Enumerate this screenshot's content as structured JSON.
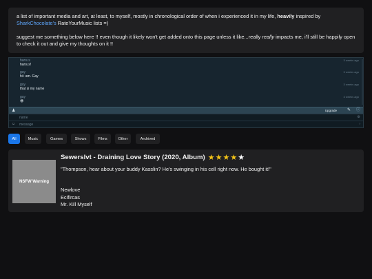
{
  "intro": {
    "line1_a": "a list of important media and art, at least, to myself, mostly in chronological order of when i experienced it in my life, ",
    "line1_bold": "heavily",
    "line1_b": " inspired by ",
    "link": "SharkChocolate's",
    "line1_c": " RateYourMusic lists =)",
    "line2_a": "suggest me something below here !! even though it likely won't get added onto this page unless it like...really ",
    "line2_italic": "really",
    "line2_b": " impacts me, i'll still be happily open to check it out and give my thoughts on it !!"
  },
  "chat": {
    "messages": [
      {
        "user": "hans.s",
        "text": "hans.s!",
        "time": "3 weeks ago"
      },
      {
        "user": "guy",
        "text": "hi i am. Gay",
        "time": "3 weeks ago"
      },
      {
        "user": "guy",
        "text": "that si my name",
        "time": "3 weeks ago"
      },
      {
        "user": "guy",
        "text": "😎",
        "time": "3 weeks ago"
      }
    ],
    "upgrade_label": "Upgrade",
    "name_placeholder": "name",
    "message_placeholder": "message",
    "icons": {
      "person": "person-icon",
      "edit": "edit-icon",
      "info": "info-icon",
      "emoji": "emoji-icon"
    }
  },
  "tabs": [
    "All",
    "Music",
    "Games",
    "Shows",
    "Films",
    "Other",
    "Archived"
  ],
  "active_tab": "All",
  "card": {
    "thumb_label": "NSFW Warning",
    "title": "Sewerslvt - Draining Love Story (2020, Album)",
    "rating": 4,
    "rating_max": 5,
    "quote": "\"Thompson, hear about your buddy Kasslin? He's swinging in his cell right now. He bought it!\"",
    "tracks": [
      "Newlove",
      "Ecifircas",
      "Mr. Kill Myself"
    ]
  },
  "colors": {
    "accent": "#1a76e8",
    "star": "#f5c518",
    "link": "#5ea8ff"
  }
}
